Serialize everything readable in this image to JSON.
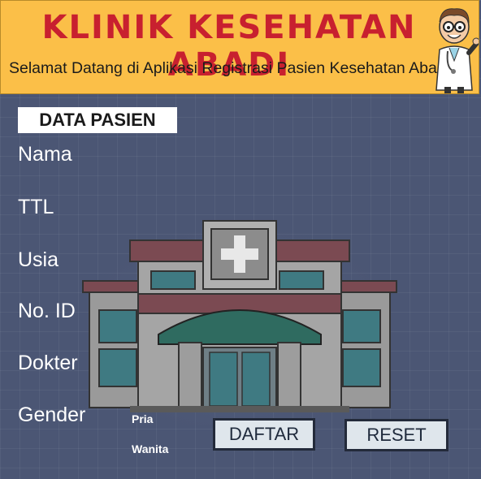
{
  "header": {
    "title": "KLINIK KESEHATAN ABADI",
    "subtitle": "Selamat Datang di Aplikasi Registrasi Pasien Kesehatan Abadi"
  },
  "form": {
    "section_title": "DATA PASIEN",
    "labels": {
      "nama": "Nama",
      "ttl": "TTL",
      "usia": "Usia",
      "no_id": "No. ID",
      "dokter": "Dokter",
      "gender": "Gender"
    },
    "gender_options": [
      "Pria",
      "Wanita"
    ]
  },
  "buttons": {
    "daftar": "DAFTAR",
    "reset": "RESET"
  },
  "colors": {
    "header_bg": "#fbbf48",
    "title_red": "#c8202f",
    "page_bg": "#4b5674"
  },
  "icons": [
    "doctor-mascot",
    "hospital-building-illustration"
  ]
}
